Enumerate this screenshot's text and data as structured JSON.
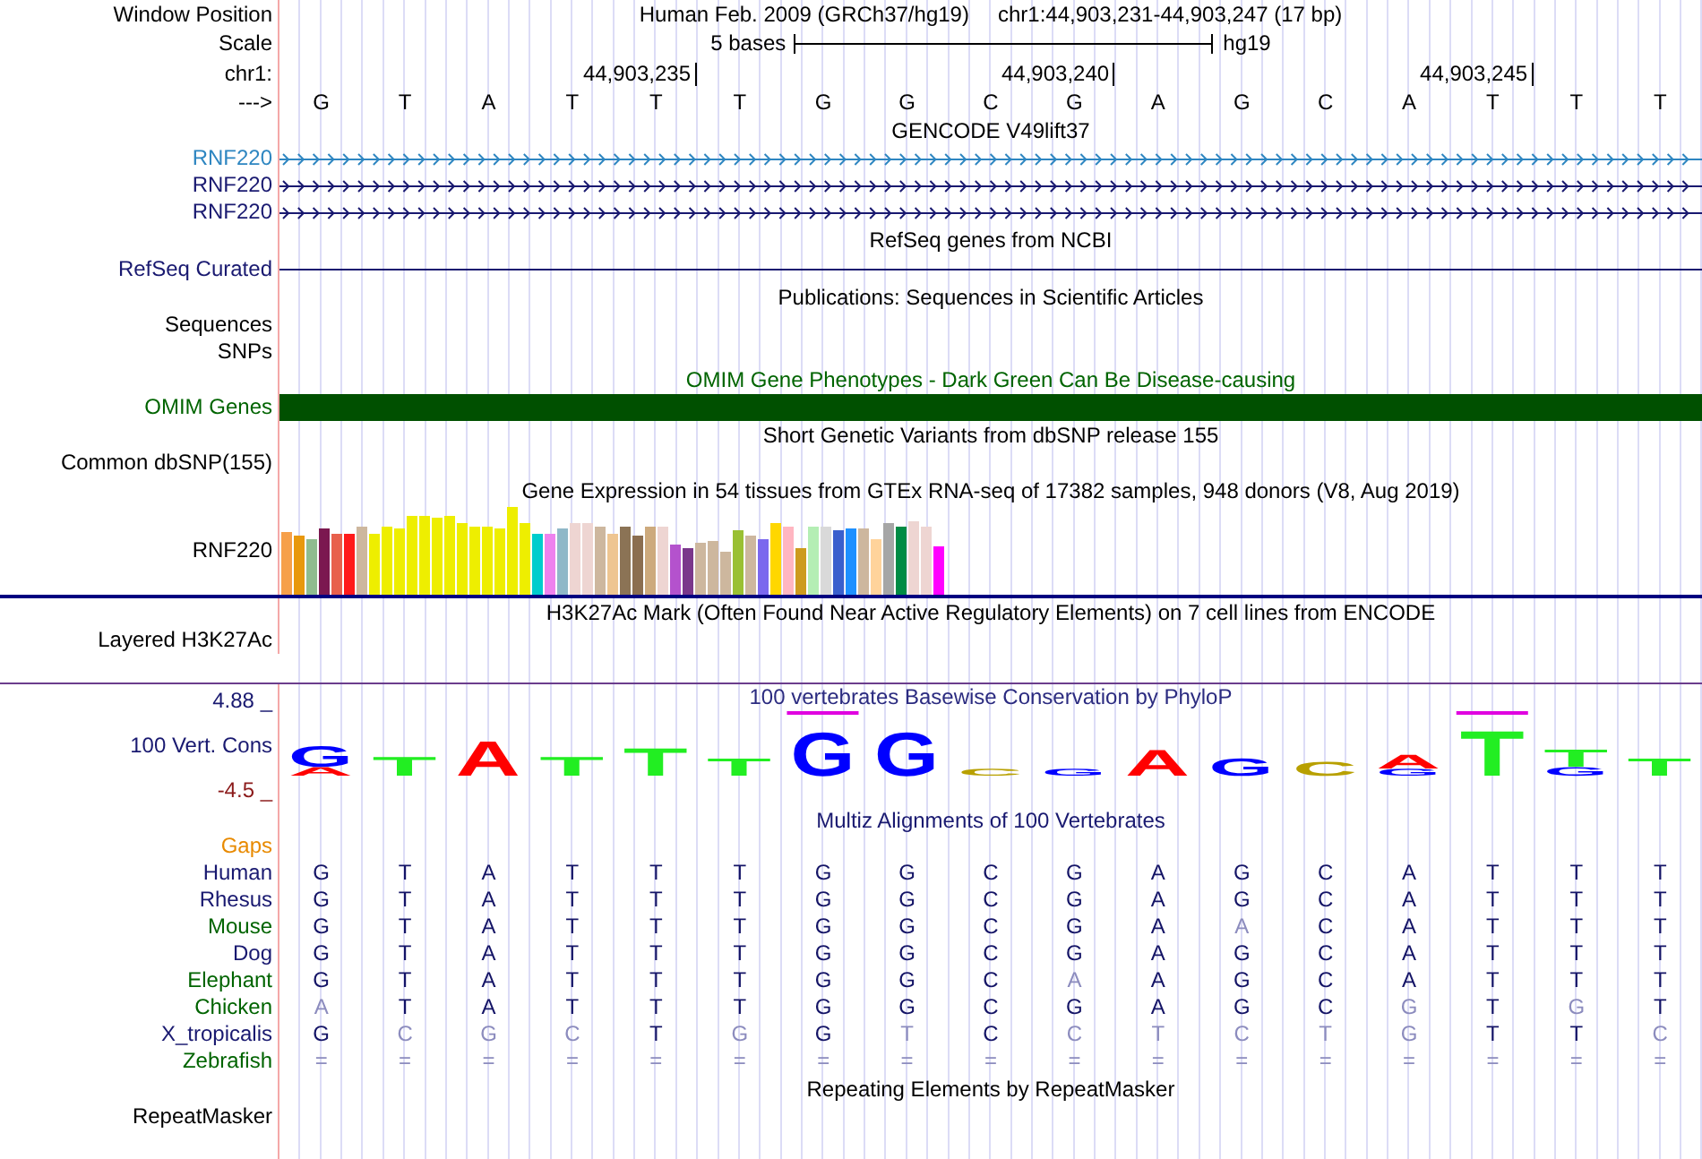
{
  "position": {
    "label": "Window Position",
    "assembly": "Human Feb. 2009 (GRCh37/hg19)",
    "range": "chr1:44,903,231-44,903,247 (17 bp)"
  },
  "scale": {
    "label": "Scale",
    "bar": "5 bases",
    "db": "hg19"
  },
  "coordinates": {
    "label": "chr1:",
    "ticks": [
      "44,903,235",
      "44,903,240",
      "44,903,245"
    ]
  },
  "sequence": {
    "label": "--->",
    "bases": [
      "G",
      "T",
      "A",
      "T",
      "T",
      "T",
      "G",
      "G",
      "C",
      "G",
      "A",
      "G",
      "C",
      "A",
      "T",
      "T",
      "T"
    ]
  },
  "tracks": [
    {
      "kind": "genes",
      "title": "GENCODE V49lift37",
      "rows": [
        {
          "label": "RNF220",
          "color": "#2e86c1"
        },
        {
          "label": "RNF220",
          "color": "#191970"
        },
        {
          "label": "RNF220",
          "color": "#191970"
        }
      ]
    },
    {
      "kind": "line",
      "title": "RefSeq genes from NCBI",
      "label": "RefSeq Curated"
    },
    {
      "kind": "empty",
      "title": "Publications: Sequences in Scientific Articles",
      "labels": [
        "Sequences",
        "SNPs"
      ]
    },
    {
      "kind": "bar",
      "title": "OMIM Gene Phenotypes - Dark Green Can Be Disease-causing",
      "label": "OMIM Genes"
    },
    {
      "kind": "empty",
      "title": "Short Genetic Variants from dbSNP release 155",
      "labels": [
        "Common dbSNP(155)"
      ]
    },
    {
      "kind": "expression",
      "title": "Gene Expression in 54 tissues from GTEx RNA-seq of 17382 samples, 948 donors (V8, Aug 2019)",
      "label": "RNF220"
    },
    {
      "kind": "empty",
      "title": "H3K27Ac Mark (Often Found Near Active Regulatory Elements) on 7 cell lines from ENCODE",
      "labels": [
        "Layered H3K27Ac"
      ]
    },
    {
      "kind": "conservation",
      "title": "100 vertebrates Basewise Conservation by PhyloP",
      "label": "100 Vert. Cons",
      "max": "4.88 _",
      "min": "-4.5 _",
      "logo": [
        {
          "highlighted": false,
          "letters": [
            {
              "base": "G",
              "color": "#0000ff"
            },
            {
              "base": "A",
              "color": "#ff0000"
            }
          ]
        },
        {
          "highlighted": false,
          "letters": [
            {
              "base": "T",
              "color": "#22ee22"
            }
          ]
        },
        {
          "highlighted": false,
          "letters": [
            {
              "base": "A",
              "color": "#ff0000"
            }
          ]
        },
        {
          "highlighted": false,
          "letters": [
            {
              "base": "T",
              "color": "#22ee22"
            }
          ]
        },
        {
          "highlighted": false,
          "letters": [
            {
              "base": "T",
              "color": "#22ee22"
            }
          ]
        },
        {
          "highlighted": false,
          "letters": [
            {
              "base": "T",
              "color": "#22ee22"
            }
          ]
        },
        {
          "highlighted": true,
          "letters": [
            {
              "base": "G",
              "color": "#0000ff"
            }
          ]
        },
        {
          "highlighted": false,
          "letters": [
            {
              "base": "G",
              "color": "#0000ff"
            }
          ]
        },
        {
          "highlighted": false,
          "letters": [
            {
              "base": "C",
              "color": "#b8a000"
            }
          ]
        },
        {
          "highlighted": false,
          "letters": [
            {
              "base": "G",
              "color": "#0000ff"
            }
          ]
        },
        {
          "highlighted": false,
          "letters": [
            {
              "base": "A",
              "color": "#ff0000"
            }
          ]
        },
        {
          "highlighted": false,
          "letters": [
            {
              "base": "G",
              "color": "#0000ff"
            }
          ]
        },
        {
          "highlighted": false,
          "letters": [
            {
              "base": "C",
              "color": "#b8a000"
            }
          ]
        },
        {
          "highlighted": false,
          "letters": [
            {
              "base": "A",
              "color": "#ff0000"
            },
            {
              "base": "G",
              "color": "#0000ff"
            }
          ]
        },
        {
          "highlighted": true,
          "letters": [
            {
              "base": "T",
              "color": "#22ee22"
            }
          ]
        },
        {
          "highlighted": false,
          "letters": [
            {
              "base": "T",
              "color": "#22ee22"
            },
            {
              "base": "G",
              "color": "#0000ff"
            }
          ]
        },
        {
          "highlighted": false,
          "letters": [
            {
              "base": "T",
              "color": "#22ee22"
            }
          ]
        }
      ]
    },
    {
      "kind": "alignment",
      "title": "Multiz Alignments of 100 Vertebrates",
      "gaps": "Gaps",
      "species": [
        {
          "name": "Human",
          "color": "#191970",
          "bases": [
            "G",
            "T",
            "A",
            "T",
            "T",
            "T",
            "G",
            "G",
            "C",
            "G",
            "A",
            "G",
            "C",
            "A",
            "T",
            "T",
            "T"
          ],
          "match": [
            true,
            true,
            true,
            true,
            true,
            true,
            true,
            true,
            true,
            true,
            true,
            true,
            true,
            true,
            true,
            true,
            true
          ]
        },
        {
          "name": "Rhesus",
          "color": "#191970",
          "bases": [
            "G",
            "T",
            "A",
            "T",
            "T",
            "T",
            "G",
            "G",
            "C",
            "G",
            "A",
            "G",
            "C",
            "A",
            "T",
            "T",
            "T"
          ],
          "match": [
            true,
            true,
            true,
            true,
            true,
            true,
            true,
            true,
            true,
            true,
            true,
            true,
            true,
            true,
            true,
            true,
            true
          ]
        },
        {
          "name": "Mouse",
          "color": "#006400",
          "bases": [
            "G",
            "T",
            "A",
            "T",
            "T",
            "T",
            "G",
            "G",
            "C",
            "G",
            "A",
            "A",
            "C",
            "A",
            "T",
            "T",
            "T"
          ],
          "match": [
            true,
            true,
            true,
            true,
            true,
            true,
            true,
            true,
            true,
            true,
            true,
            false,
            true,
            true,
            true,
            true,
            true
          ]
        },
        {
          "name": "Dog",
          "color": "#191970",
          "bases": [
            "G",
            "T",
            "A",
            "T",
            "T",
            "T",
            "G",
            "G",
            "C",
            "G",
            "A",
            "G",
            "C",
            "A",
            "T",
            "T",
            "T"
          ],
          "match": [
            true,
            true,
            true,
            true,
            true,
            true,
            true,
            true,
            true,
            true,
            true,
            true,
            true,
            true,
            true,
            true,
            true
          ]
        },
        {
          "name": "Elephant",
          "color": "#006400",
          "bases": [
            "G",
            "T",
            "A",
            "T",
            "T",
            "T",
            "G",
            "G",
            "C",
            "A",
            "A",
            "G",
            "C",
            "A",
            "T",
            "T",
            "T"
          ],
          "match": [
            true,
            true,
            true,
            true,
            true,
            true,
            true,
            true,
            true,
            false,
            true,
            true,
            true,
            true,
            true,
            true,
            true
          ]
        },
        {
          "name": "Chicken",
          "color": "#006400",
          "bases": [
            "A",
            "T",
            "A",
            "T",
            "T",
            "T",
            "G",
            "G",
            "C",
            "G",
            "A",
            "G",
            "C",
            "G",
            "T",
            "G",
            "T"
          ],
          "match": [
            false,
            true,
            true,
            true,
            true,
            true,
            true,
            true,
            true,
            true,
            true,
            true,
            true,
            false,
            true,
            false,
            true
          ]
        },
        {
          "name": "X_tropicalis",
          "color": "#191970",
          "bases": [
            "G",
            "C",
            "G",
            "C",
            "T",
            "G",
            "G",
            "T",
            "C",
            "C",
            "T",
            "C",
            "T",
            "G",
            "T",
            "T",
            "C"
          ],
          "match": [
            true,
            false,
            false,
            false,
            true,
            false,
            true,
            false,
            true,
            false,
            false,
            false,
            false,
            false,
            true,
            true,
            false
          ]
        },
        {
          "name": "Zebrafish",
          "color": "#006400",
          "bases": [
            "=",
            "=",
            "=",
            "=",
            "=",
            "=",
            "=",
            "=",
            "=",
            "=",
            "=",
            "=",
            "=",
            "=",
            "=",
            "=",
            "="
          ],
          "match": [
            false,
            false,
            false,
            false,
            false,
            false,
            false,
            false,
            false,
            false,
            false,
            false,
            false,
            false,
            false,
            false,
            false
          ]
        }
      ]
    },
    {
      "kind": "empty",
      "title": "Repeating Elements by RepeatMasker",
      "labels": [
        "RepeatMasker"
      ]
    }
  ]
}
